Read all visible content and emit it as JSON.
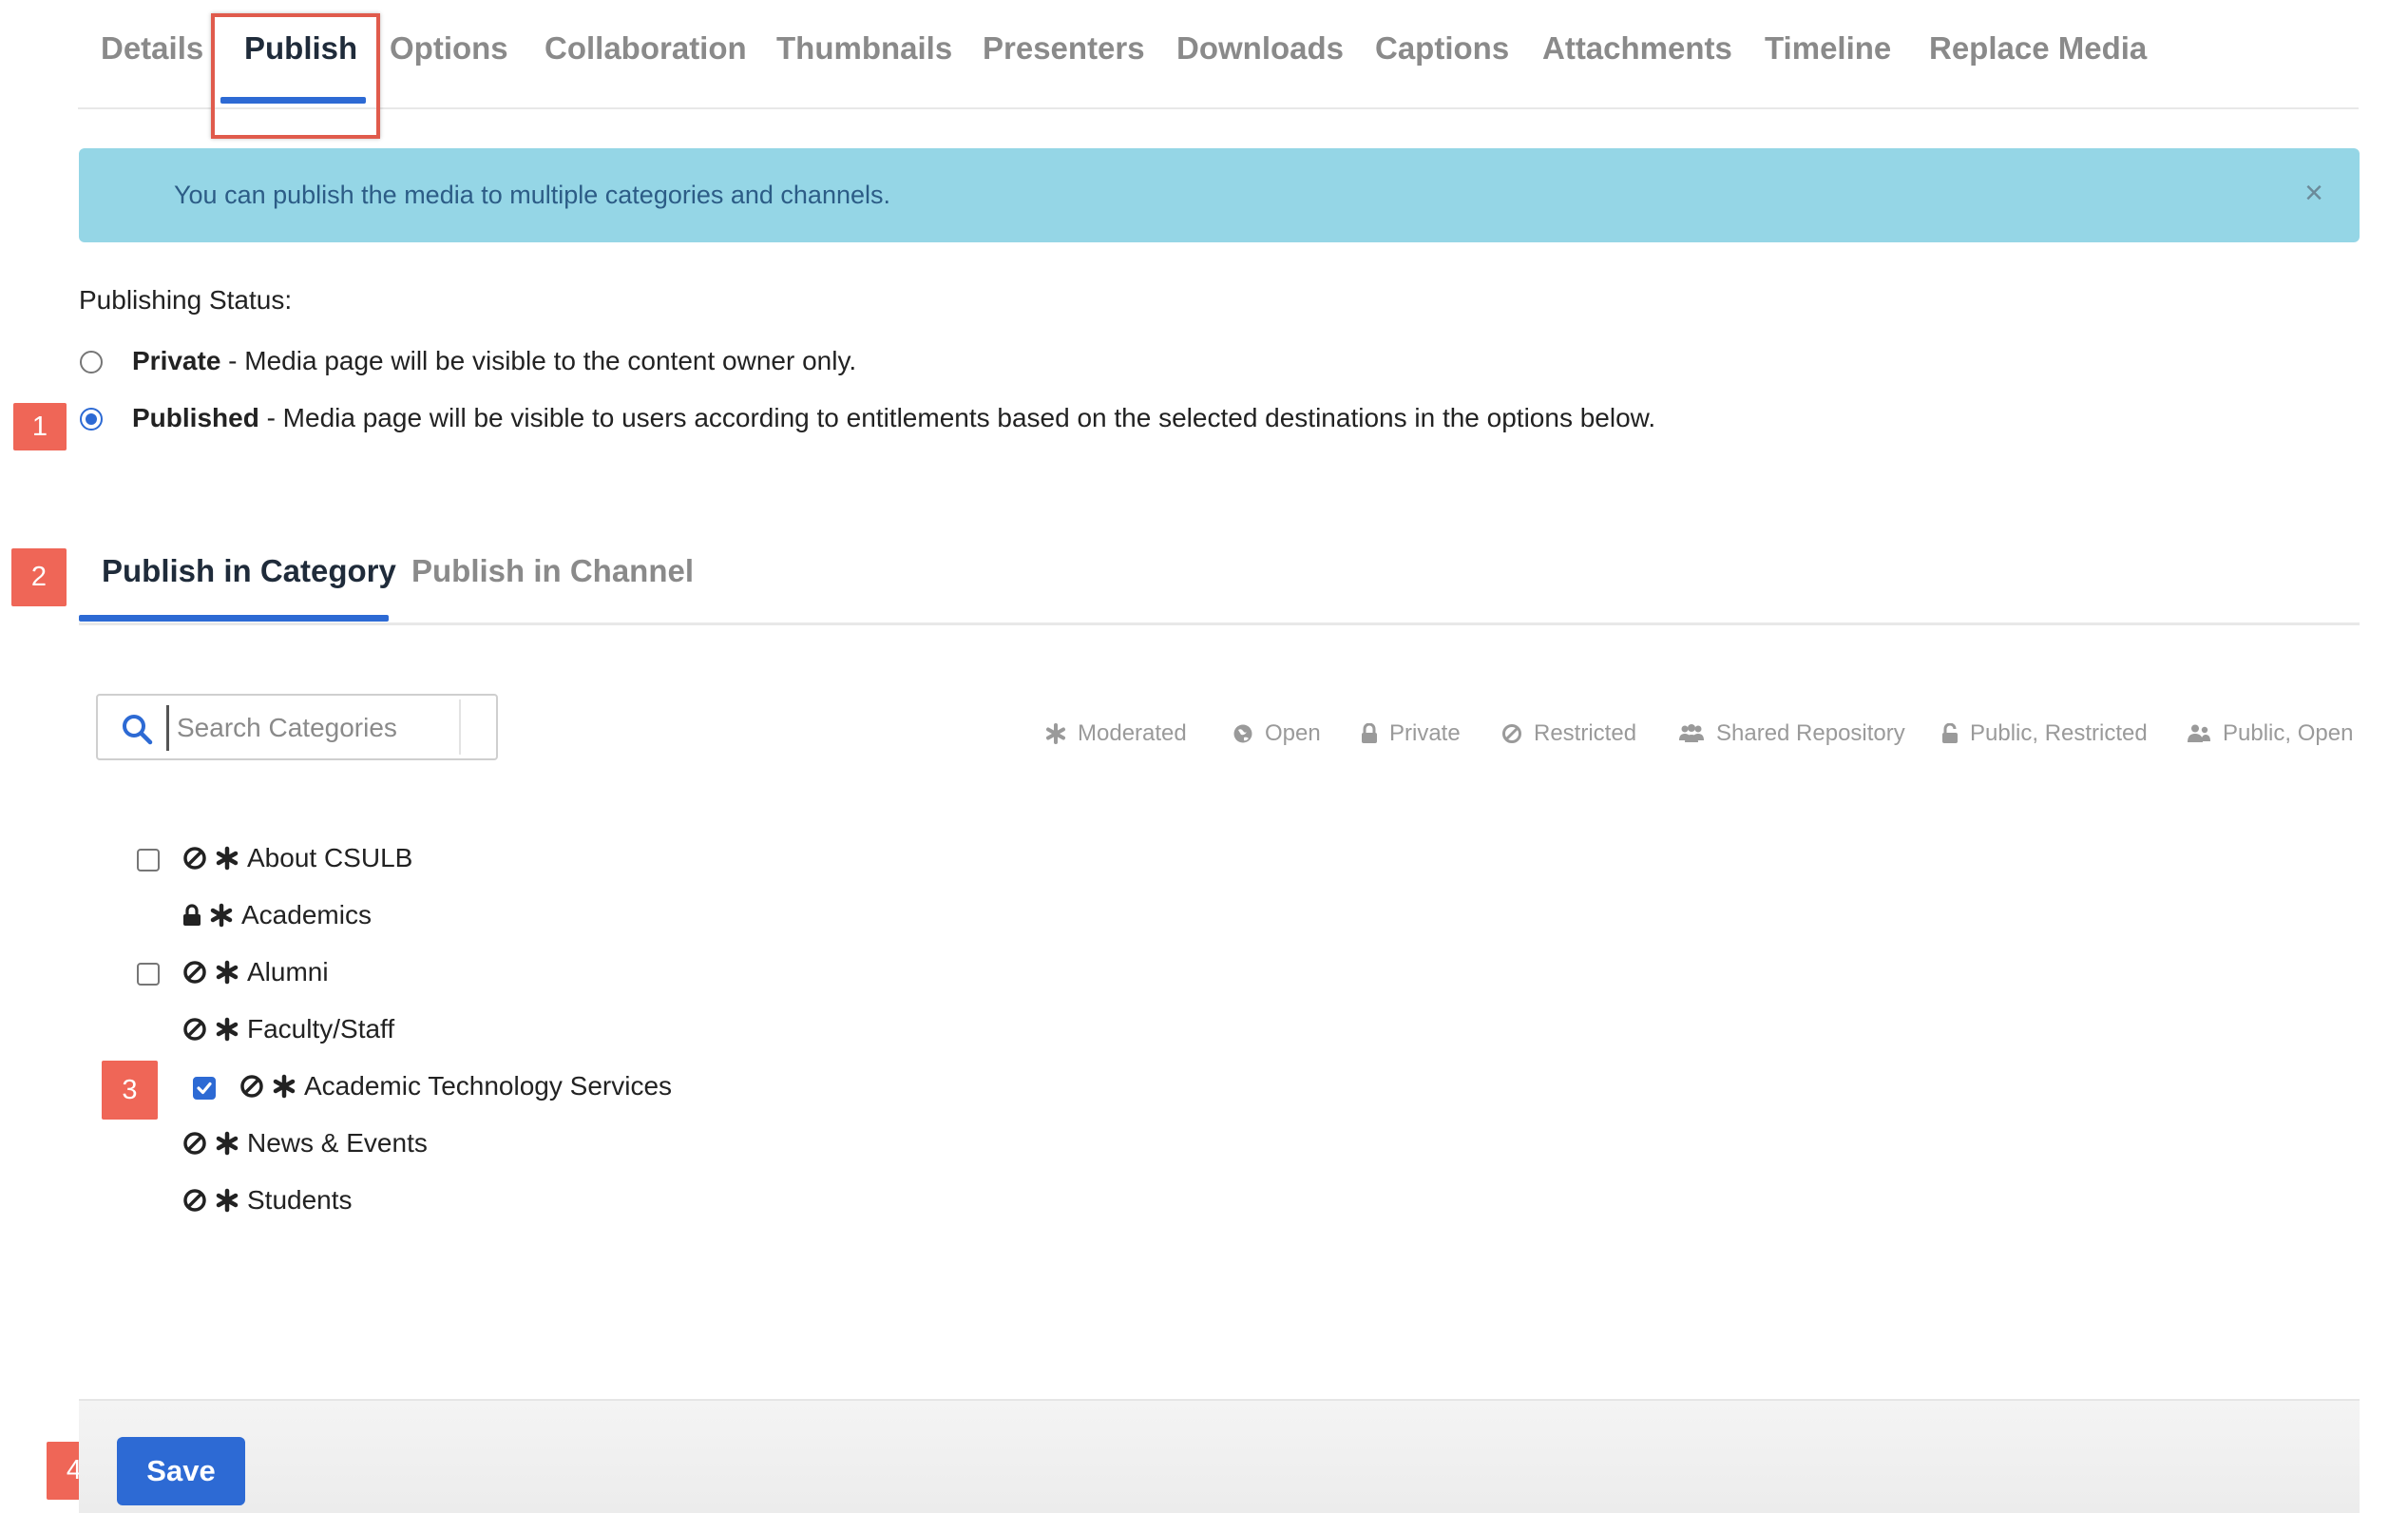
{
  "top_tabs": [
    {
      "label": "Details"
    },
    {
      "label": "Publish",
      "active": true
    },
    {
      "label": "Options"
    },
    {
      "label": "Collaboration"
    },
    {
      "label": "Thumbnails"
    },
    {
      "label": "Presenters"
    },
    {
      "label": "Downloads"
    },
    {
      "label": "Captions"
    },
    {
      "label": "Attachments"
    },
    {
      "label": "Timeline"
    },
    {
      "label": "Replace Media"
    }
  ],
  "alert": {
    "message": "You can publish the media to multiple categories and channels.",
    "close_glyph": "×"
  },
  "publishing": {
    "status_label": "Publishing Status:",
    "options": [
      {
        "title": "Private",
        "description": " - Media page will be visible to the content owner only.",
        "selected": false
      },
      {
        "title": "Published",
        "description": " - Media page will be visible to users according to entitlements based on the selected destinations in the options below.",
        "selected": true
      }
    ]
  },
  "markers": [
    "1",
    "2",
    "3",
    "4"
  ],
  "sub_tabs": [
    {
      "label": "Publish in Category",
      "active": true
    },
    {
      "label": "Publish in Channel",
      "active": false
    }
  ],
  "search": {
    "placeholder": "Search Categories",
    "value": ""
  },
  "legend": [
    {
      "label": "Moderated",
      "icon": "asterisk-icon"
    },
    {
      "label": "Open",
      "icon": "globe-icon"
    },
    {
      "label": "Private",
      "icon": "lock-icon"
    },
    {
      "label": "Restricted",
      "icon": "ban-icon"
    },
    {
      "label": "Shared Repository",
      "icon": "group-icon"
    },
    {
      "label": "Public, Restricted",
      "icon": "unlock-icon"
    },
    {
      "label": "Public, Open",
      "icon": "users-icon"
    }
  ],
  "categories": [
    {
      "name": "About CSULB",
      "checkbox": true,
      "checked": false,
      "icons": [
        "ban-icon",
        "asterisk-icon"
      ]
    },
    {
      "name": "Academics",
      "checkbox": false,
      "checked": false,
      "icons": [
        "lock-icon",
        "asterisk-icon"
      ]
    },
    {
      "name": "Alumni",
      "checkbox": true,
      "checked": false,
      "icons": [
        "ban-icon",
        "asterisk-icon"
      ]
    },
    {
      "name": "Faculty/Staff",
      "checkbox": false,
      "checked": false,
      "icons": [
        "ban-icon",
        "asterisk-icon"
      ]
    },
    {
      "name": "Academic Technology Services",
      "checkbox": true,
      "checked": true,
      "icons": [
        "ban-icon",
        "asterisk-icon"
      ]
    },
    {
      "name": "News & Events",
      "checkbox": false,
      "checked": false,
      "icons": [
        "ban-icon",
        "asterisk-icon"
      ]
    },
    {
      "name": "Students",
      "checkbox": false,
      "checked": false,
      "icons": [
        "ban-icon",
        "asterisk-icon"
      ]
    }
  ],
  "footer": {
    "save_label": "Save"
  },
  "colors": {
    "accent": "#2d6ad4",
    "alert_bg": "#95d6e6",
    "marker": "#ef6657",
    "highlight": "#e05b4c"
  }
}
